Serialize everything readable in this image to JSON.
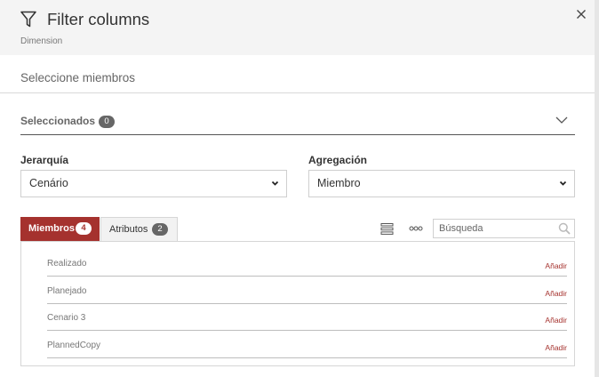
{
  "header": {
    "title": "Filter columns",
    "subtitle": "Dimension"
  },
  "prompt": "Seleccione miembros",
  "selected": {
    "label": "Seleccionados",
    "count": "0"
  },
  "hierarchy": {
    "label": "Jerarquía",
    "value": "Cenário"
  },
  "aggregation": {
    "label": "Agregación",
    "value": "Miembro"
  },
  "tabs": [
    {
      "label": "Miembros",
      "count": "4"
    },
    {
      "label": "Atributos",
      "count": "2"
    }
  ],
  "search": {
    "placeholder": "Búsqueda"
  },
  "members": [
    {
      "name": "Realizado",
      "action": "Añadir"
    },
    {
      "name": "Planejado",
      "action": "Añadir"
    },
    {
      "name": "Cenario 3",
      "action": "Añadir"
    },
    {
      "name": "PlannedCopy",
      "action": "Añadir"
    }
  ],
  "colors": {
    "accent": "#a5322e",
    "header_bg": "#f4f4f4",
    "badge_gray": "#666666"
  }
}
